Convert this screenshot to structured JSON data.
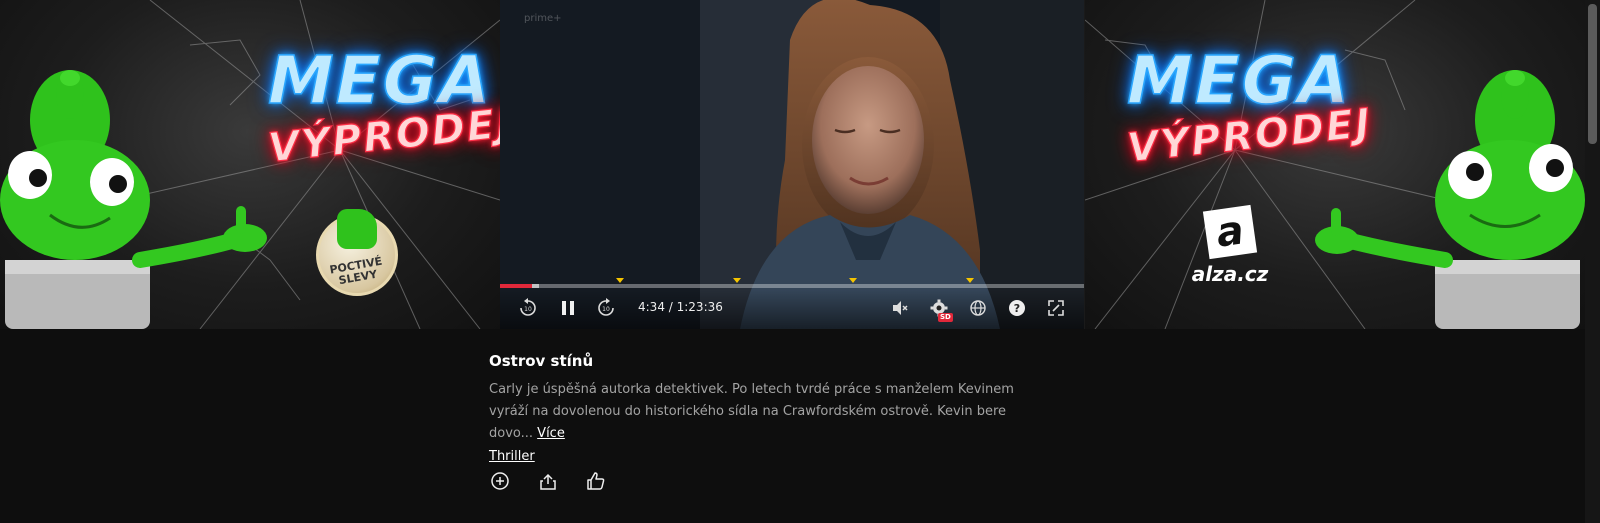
{
  "ads": {
    "left": {
      "headline": "MEGA",
      "subheadline": "VÝPRODEJ",
      "badge": "POCTIVÉ SLEVY"
    },
    "right": {
      "headline": "MEGA",
      "subheadline": "VÝPRODEJ",
      "brand": "alza.cz",
      "logo_letter": "a"
    }
  },
  "player": {
    "watermark": "prime+",
    "time_display": "4:34 / 1:23:36",
    "played_fraction": 0.055,
    "buffered_fraction": 0.066,
    "quality_badge": "SD",
    "accent": "#e1283a",
    "marker_color": "#f5c400",
    "chapter_markers": [
      0.205,
      0.405,
      0.605,
      0.805
    ],
    "controls": {
      "rewind_icon": "rewind-10-icon",
      "pause_icon": "pause-icon",
      "forward_icon": "forward-10-icon",
      "mute_icon": "volume-muted-icon",
      "settings_icon": "gear-icon",
      "language_icon": "globe-icon",
      "help_icon": "help-icon",
      "fullscreen_icon": "fullscreen-icon"
    }
  },
  "movie": {
    "title": "Ostrov stínů",
    "description": "Carly je úspěšná autorka detektivek. Po letech tvrdé práce s manželem Kevinem vyráží na dovolenou do historického sídla na Crawfordském ostrově. Kevin bere dovo...",
    "more_label": "Více",
    "genre": "Thriller"
  },
  "actions": {
    "add_icon": "add-circle-icon",
    "share_icon": "share-icon",
    "like_icon": "thumbs-up-icon"
  }
}
